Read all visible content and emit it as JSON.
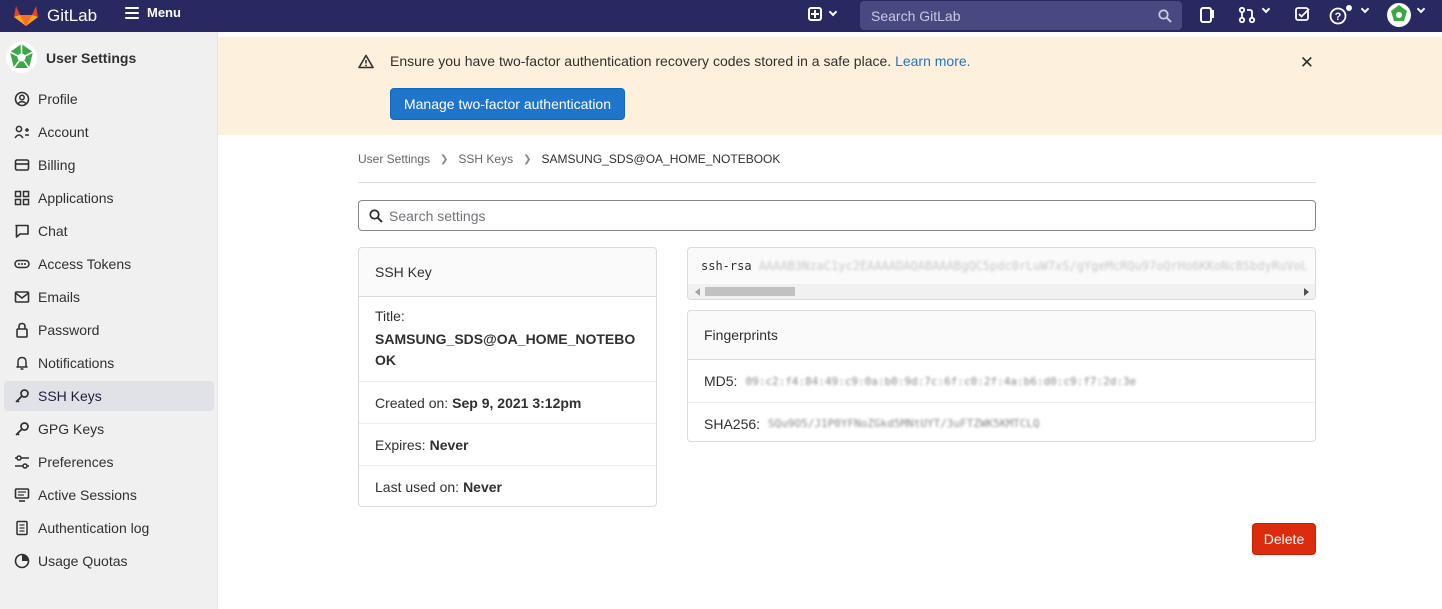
{
  "topbar": {
    "brand": "GitLab",
    "menu_label": "Menu",
    "search_placeholder": "Search GitLab"
  },
  "sidebar": {
    "title": "User Settings",
    "items": [
      {
        "label": "Profile",
        "icon": "profile-icon"
      },
      {
        "label": "Account",
        "icon": "account-icon"
      },
      {
        "label": "Billing",
        "icon": "billing-icon"
      },
      {
        "label": "Applications",
        "icon": "applications-icon"
      },
      {
        "label": "Chat",
        "icon": "chat-icon"
      },
      {
        "label": "Access Tokens",
        "icon": "token-icon"
      },
      {
        "label": "Emails",
        "icon": "mail-icon"
      },
      {
        "label": "Password",
        "icon": "lock-icon"
      },
      {
        "label": "Notifications",
        "icon": "bell-icon"
      },
      {
        "label": "SSH Keys",
        "icon": "key-icon",
        "active": true
      },
      {
        "label": "GPG Keys",
        "icon": "key-icon"
      },
      {
        "label": "Preferences",
        "icon": "preferences-icon"
      },
      {
        "label": "Active Sessions",
        "icon": "monitor-icon"
      },
      {
        "label": "Authentication log",
        "icon": "log-icon"
      },
      {
        "label": "Usage Quotas",
        "icon": "quota-icon"
      }
    ]
  },
  "alert": {
    "message": "Ensure you have two-factor authentication recovery codes stored in a safe place.",
    "link": "Learn more.",
    "button": "Manage two-factor authentication"
  },
  "breadcrumb": [
    "User Settings",
    "SSH Keys",
    "SAMSUNG_SDS@OA_HOME_NOTEBOOK"
  ],
  "settings_search_placeholder": "Search settings",
  "key_card": {
    "header": "SSH Key",
    "title_label": "Title:",
    "title_value": "SAMSUNG_SDS@OA_HOME_NOTEBOOK",
    "created_label": "Created on:",
    "created_value": "Sep 9, 2021 3:12pm",
    "expires_label": "Expires:",
    "expires_value": "Never",
    "last_used_label": "Last used on:",
    "last_used_value": "Never"
  },
  "key_body": {
    "type": "ssh-rsa",
    "key": "AAAAB3NzaC1yc2EAAAADAQABAAABgQC5pdc0rLuW7xS/gYgeMcRQu97oQrHo6KKoNc8SbdyRuVoL"
  },
  "fingerprints": {
    "header": "Fingerprints",
    "md5_label": "MD5:",
    "md5_value": "09:c2:f4:84:49:c9:0a:b0:9d:7c:6f:c0:2f:4a:b6:d0:c9:f7:2d:3e",
    "sha256_label": "SHA256:",
    "sha256_value": "SQu9O5/J1P0YFNoZGkd5MNtUYT/3uFTZWK5KMTCLQ"
  },
  "delete_button": "Delete",
  "colors": {
    "navbar": "#292961",
    "alert_bg": "#fdf1dd",
    "primary": "#1f75cb",
    "danger": "#dd2b0e"
  }
}
